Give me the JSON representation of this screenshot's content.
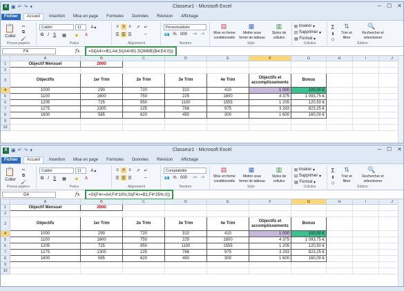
{
  "windows": [
    {
      "id": "w0",
      "app_title": "Classeur1 - Microsoft Excel",
      "name_box": "F4",
      "formula": "=SI(A4<=B1;A4;SI(A4>B1;SOMME(B4:E4;0)))",
      "number_format": "Personnalisée",
      "selected_col": "F"
    },
    {
      "id": "w1",
      "app_title": "Classeur1 - Microsoft Excel",
      "name_box": "G4",
      "formula": "=SI(F4<=A4;F4*10%;SI(F4>=B1;F4*25%;0))",
      "number_format": "Comptabilité",
      "selected_col": "G"
    }
  ],
  "tabs": [
    "Fichier",
    "Accueil",
    "Insertion",
    "Mise en page",
    "Formules",
    "Données",
    "Révision",
    "Affichage"
  ],
  "ribbon": {
    "paste": "Coller",
    "clipboard": "Presse-papiers",
    "font_group": "Police",
    "font_name": "Calibri",
    "font_size": "11",
    "align_group": "Alignement",
    "number_group": "Nombre",
    "cond_fmt": "Mise en forme conditionnelle",
    "table_fmt": "Mettre sous forme de tableau",
    "cell_styles": "Styles de cellules",
    "style_group": "Style",
    "insert": "Insérer",
    "delete": "Supprimer",
    "format": "Format",
    "cells_group": "Cellules",
    "sort": "Trier et filtrer",
    "find": "Rechercher et sélectionner",
    "edit_group": "Édition",
    "sum": "Σ",
    "pct": "%",
    "thousands": "000"
  },
  "qa_icons": [
    "save-icon",
    "undo-icon",
    "redo-icon"
  ],
  "grid": {
    "columns": [
      "A",
      "B",
      "C",
      "D",
      "E",
      "F",
      "G",
      "H",
      "I",
      "J"
    ],
    "rows": [
      "1",
      "2",
      "3",
      "4",
      "5",
      "6",
      "7",
      "8",
      "9",
      "10"
    ],
    "row1": {
      "a": "Objectif Mensuel",
      "b": "2000"
    },
    "headers": [
      "Objectifs",
      "1er Trim",
      "2e Trim",
      "3e Trim",
      "4e Trim",
      "Objectifs et accomplissements",
      "Bonus"
    ],
    "data": [
      [
        "1000",
        "290",
        "720",
        "310",
        "410",
        "1 000",
        "100,00 €"
      ],
      [
        "1100",
        "1600",
        "750",
        "225",
        "1800",
        "4 375",
        "1 093,75 €"
      ],
      [
        "1205",
        "725",
        "950",
        "1100",
        "1555",
        "1 205",
        "120,50 €"
      ],
      [
        "1275",
        "1305",
        "225",
        "788",
        "975",
        "3 293",
        "823,25 €"
      ],
      [
        "1600",
        "585",
        "620",
        "450",
        "300",
        "1 600",
        "160,00 €"
      ]
    ]
  },
  "accent": {
    "file_tab": "#2c6ab7",
    "formula_box": "#2e9a46",
    "purple": "#c9b8dc",
    "green": "#3cc08e"
  }
}
